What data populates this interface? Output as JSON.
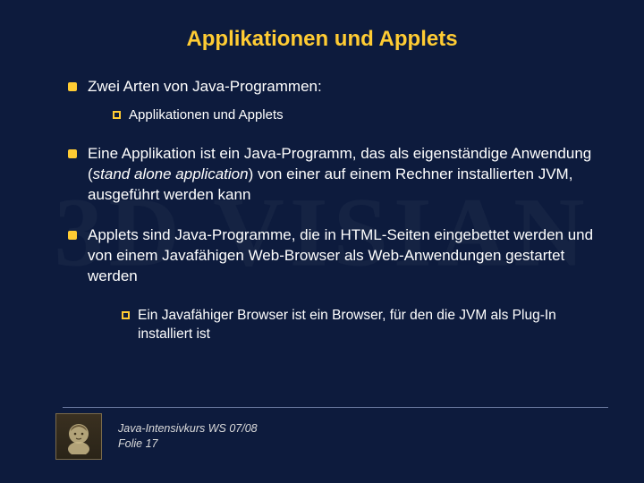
{
  "title": "Applikationen und Applets",
  "bullets": {
    "b1": "Zwei Arten von Java-Programmen:",
    "b1_sub1": "Applikationen und Applets",
    "b2_pre": "Eine Applikation ist ein Java-Programm, das als eigenständige Anwendung (",
    "b2_it": "stand alone  application",
    "b2_post": ") von einer auf einem Rechner installierten JVM, ausgeführt werden kann",
    "b3": "Applets sind Java-Programme, die in HTML-Seiten eingebettet werden und von einem Javafähigen Web-Browser als Web-Anwendungen gestartet werden",
    "b3_sub1": "Ein Javafähiger Browser ist ein Browser, für den die JVM als Plug-In installiert ist"
  },
  "footer": {
    "course": "Java-Intensivkurs WS 07/08",
    "folio": "Folie 17"
  },
  "watermark": "3D VISIAN"
}
